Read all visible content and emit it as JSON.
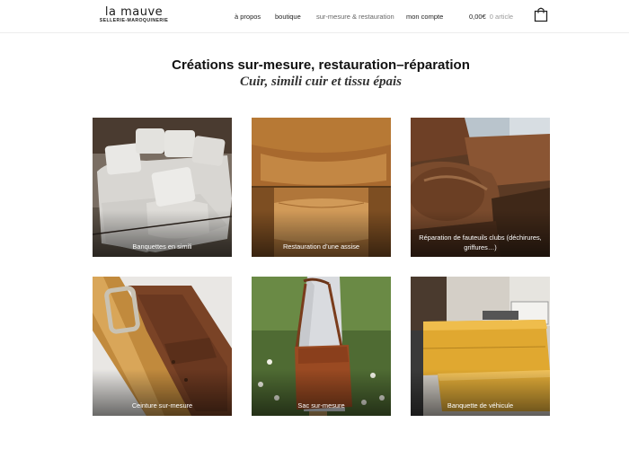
{
  "brand": {
    "name": "la mauve",
    "tagline": "SELLERIE-MAROQUINERIE"
  },
  "nav": {
    "items": [
      {
        "label": "à propos"
      },
      {
        "label": "boutique"
      },
      {
        "label": "sur-mesure & restauration"
      },
      {
        "label": "mon compte"
      }
    ]
  },
  "cart": {
    "total": "0,00€",
    "count": "0 article",
    "icon": "shopping-bag-icon"
  },
  "page": {
    "title": "Créations sur-mesure, restauration–réparation",
    "subtitle": "Cuir, simili cuir et tissu épais"
  },
  "tiles": [
    {
      "caption": "Banquettes en simili"
    },
    {
      "caption": "Restauration d’une assise"
    },
    {
      "caption": "Réparation de fauteuils clubs (déchirures, griffures…)"
    },
    {
      "caption": "Ceinture sur-mesure"
    },
    {
      "caption": "Sac sur-mesure"
    },
    {
      "caption": "Banquette de véhicule"
    }
  ]
}
